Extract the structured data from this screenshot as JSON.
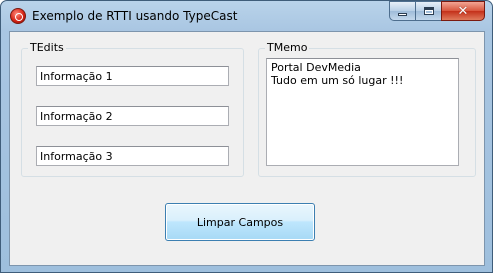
{
  "window": {
    "title": "Exemplo de RTTI usando TypeCast",
    "icon": "app-icon",
    "controls": {
      "minimize": "minimize-icon",
      "maximize": "maximize-icon",
      "close": "✕"
    }
  },
  "edits_group": {
    "label": "TEdits",
    "fields": [
      {
        "value": "Informação 1"
      },
      {
        "value": "Informação 2"
      },
      {
        "value": "Informação 3"
      }
    ]
  },
  "memo_group": {
    "label": "TMemo",
    "lines": [
      "Portal DevMedia",
      "Tudo em um só lugar !!!"
    ]
  },
  "button": {
    "label": "Limpar Campos"
  }
}
